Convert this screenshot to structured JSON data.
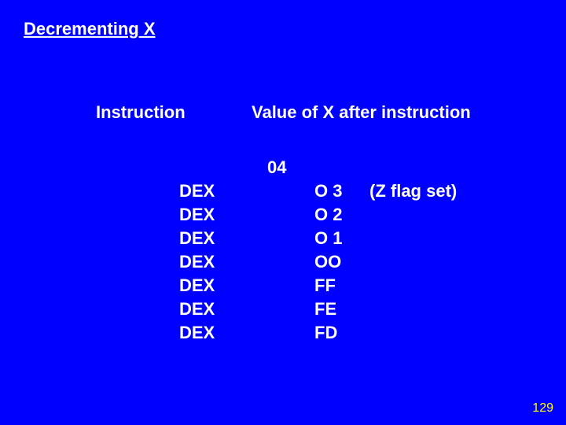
{
  "title": "Decrementing X",
  "headers": {
    "instruction": "Instruction",
    "value": "Value of X after instruction"
  },
  "initial_value": "04",
  "rows": [
    {
      "instr": "DEX",
      "val": "O 3",
      "note": ""
    },
    {
      "instr": "DEX",
      "val": "O 2",
      "note": ""
    },
    {
      "instr": "DEX",
      "val": "O 1",
      "note": ""
    },
    {
      "instr": "DEX",
      "val": "OO",
      "note": "(Z flag set)"
    },
    {
      "instr": "DEX",
      "val": "FF",
      "note": ""
    },
    {
      "instr": "DEX",
      "val": "FE",
      "note": ""
    },
    {
      "instr": "DEX",
      "val": "FD",
      "note": ""
    }
  ],
  "page_number": "129"
}
